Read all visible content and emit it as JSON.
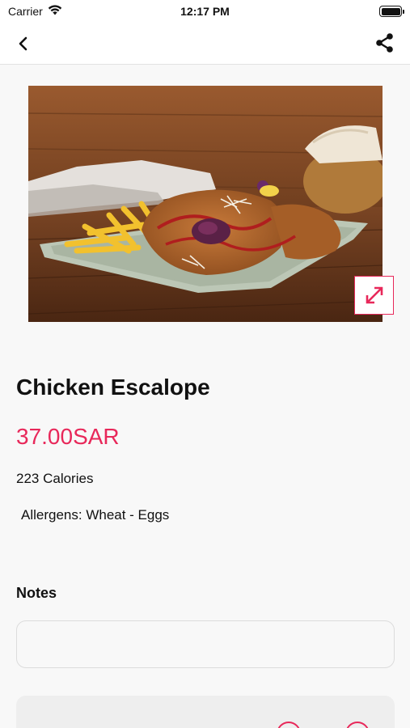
{
  "status_bar": {
    "carrier": "Carrier",
    "time": "12:17 PM",
    "icons": [
      "wifi-icon",
      "battery-icon"
    ]
  },
  "nav": {
    "back_icon": "chevron-left-icon",
    "share_icon": "share-icon"
  },
  "product": {
    "image_icon": "expand-icon",
    "title": "Chicken Escalope",
    "price": "37.00SAR",
    "calories": "223 Calories",
    "allergens": "Allergens: Wheat - Eggs"
  },
  "notes": {
    "label": "Notes",
    "value": "",
    "placeholder": ""
  },
  "colors": {
    "accent": "#e8285a",
    "background": "#f8f8f8",
    "text": "#111111"
  }
}
